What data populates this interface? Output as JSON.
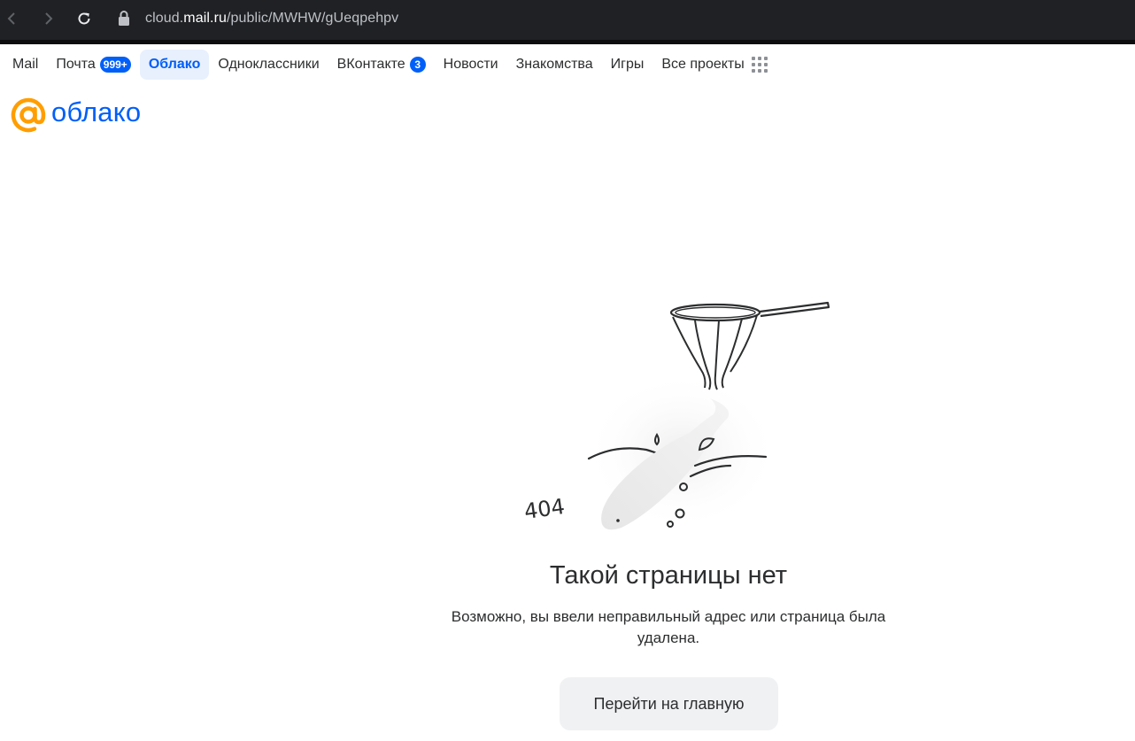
{
  "browser": {
    "url_prefix": "cloud.",
    "url_domain": "mail.ru",
    "url_path": "/public/MWHW/gUeqpehpv"
  },
  "portal_nav": {
    "items": [
      {
        "label": "Mail"
      },
      {
        "label": "Почта",
        "badge": "999+"
      },
      {
        "label": "Облако",
        "active": true
      },
      {
        "label": "Одноклассники"
      },
      {
        "label": "ВКонтакте",
        "badge": "3"
      },
      {
        "label": "Новости"
      },
      {
        "label": "Знакомства"
      },
      {
        "label": "Игры"
      },
      {
        "label": "Все проекты"
      }
    ]
  },
  "logo": {
    "text": "облако"
  },
  "illustration": {
    "code": "404"
  },
  "error": {
    "title": "Такой страницы нет",
    "text": "Возможно, вы ввели неправильный адрес или страница была удалена.",
    "button_label": "Перейти на главную"
  },
  "colors": {
    "brand_blue": "#005ff9",
    "brand_orange": "#ff9e00",
    "browser_bg": "#202124",
    "button_bg": "#f0f1f3"
  }
}
